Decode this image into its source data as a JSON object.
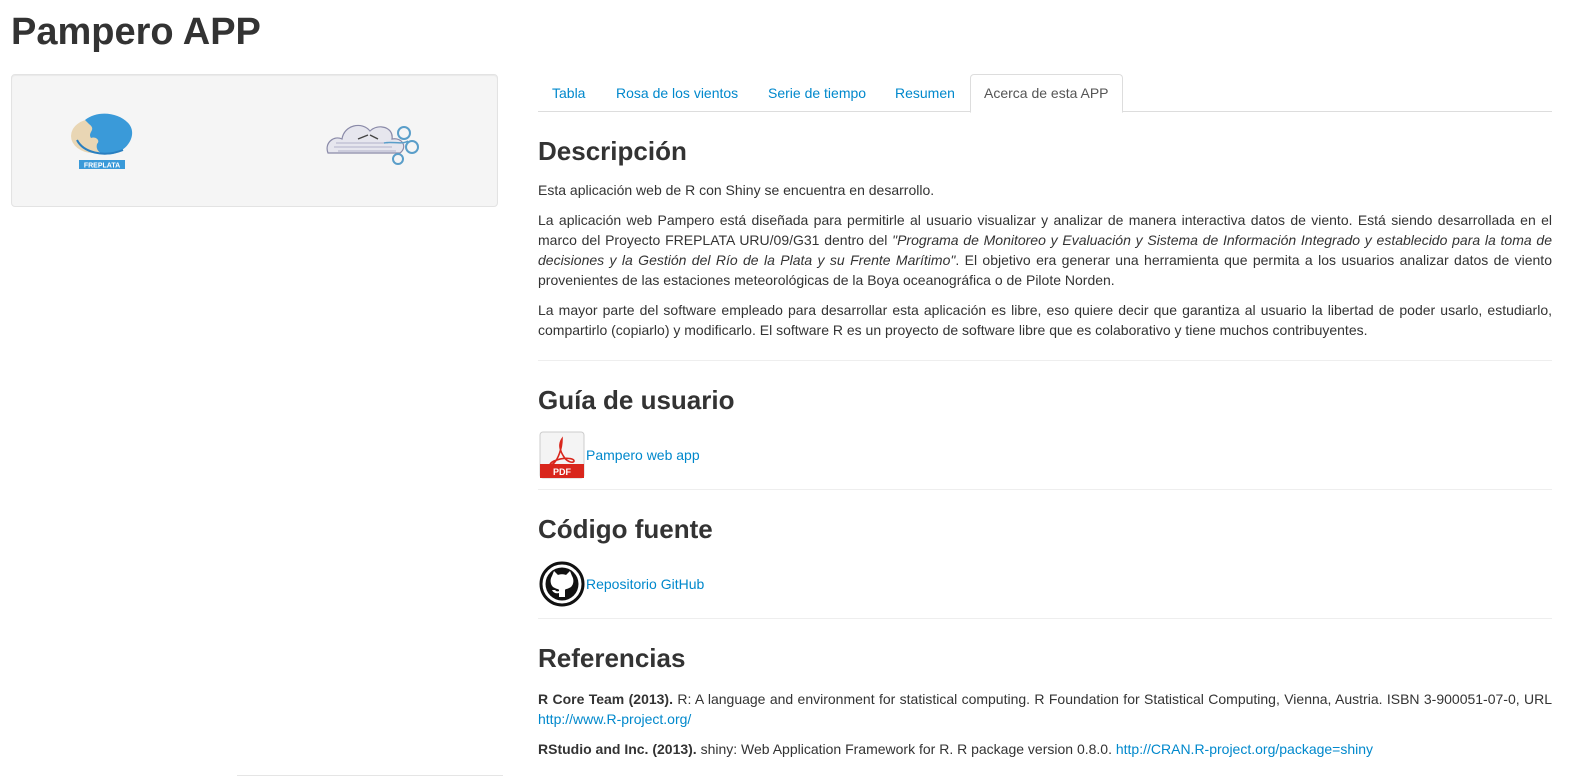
{
  "app": {
    "title": "Pampero APP"
  },
  "sidebar": {
    "logos": [
      {
        "name": "freplata-logo",
        "text": "FREPLATA"
      },
      {
        "name": "pampero-logo",
        "text": ""
      }
    ]
  },
  "tabs": [
    {
      "label": "Tabla",
      "active": false
    },
    {
      "label": "Rosa de los vientos",
      "active": false
    },
    {
      "label": "Serie de tiempo",
      "active": false
    },
    {
      "label": "Resumen",
      "active": false
    },
    {
      "label": "Acerca de esta APP",
      "active": true
    }
  ],
  "descripcion": {
    "title": "Descripción",
    "p1": "Esta aplicación web de R con Shiny se encuentra en desarrollo.",
    "p2_a": "La aplicación web Pampero está diseñada para permitirle al usuario visualizar y analizar de manera interactiva datos de viento. Está siendo desarrollada en el marco del Proyecto FREPLATA URU/09/G31 dentro del ",
    "p2_italic": "\"Programa de Monitoreo y Evaluación y Sistema de Información Integrado y establecido para la toma de decisiones y la Gestión del Río de la Plata y su Frente Marítimo\"",
    "p2_b": ". El objetivo era generar una herramienta que permita a los usuarios analizar datos de viento provenientes de las estaciones meteorológicas de la Boya oceanográfica o de Pilote Norden.",
    "p3": "La mayor parte del software empleado para desarrollar esta aplicación es libre, eso quiere decir que garantiza al usuario la libertad de poder usarlo, estudiarlo, compartirlo (copiarlo) y modificarlo. El software R es un proyecto de software libre que es colaborativo y tiene muchos contribuyentes."
  },
  "guia": {
    "title": "Guía de usuario",
    "pdf_icon_text": "PDF",
    "link": "Pampero web app"
  },
  "codigo": {
    "title": "Código fuente",
    "link": "Repositorio GitHub"
  },
  "referencias": {
    "title": "Referencias",
    "items": [
      {
        "author": "R Core Team (2013).",
        "text": " R: A language and environment for statistical computing. R Foundation for Statistical Computing, Vienna, Austria. ISBN 3-900051-07-0, URL ",
        "url": "http://www.R-project.org/"
      },
      {
        "author": "RStudio and Inc. (2013).",
        "text": " shiny: Web Application Framework for R. R package version 0.8.0. ",
        "url": "http://CRAN.R-project.org/package=shiny"
      }
    ]
  },
  "colors": {
    "link": "#0088cc",
    "text": "#333333",
    "well_bg": "#f5f5f5",
    "freplata_blue": "#3a9ad9",
    "pdf_red": "#d9261c"
  }
}
